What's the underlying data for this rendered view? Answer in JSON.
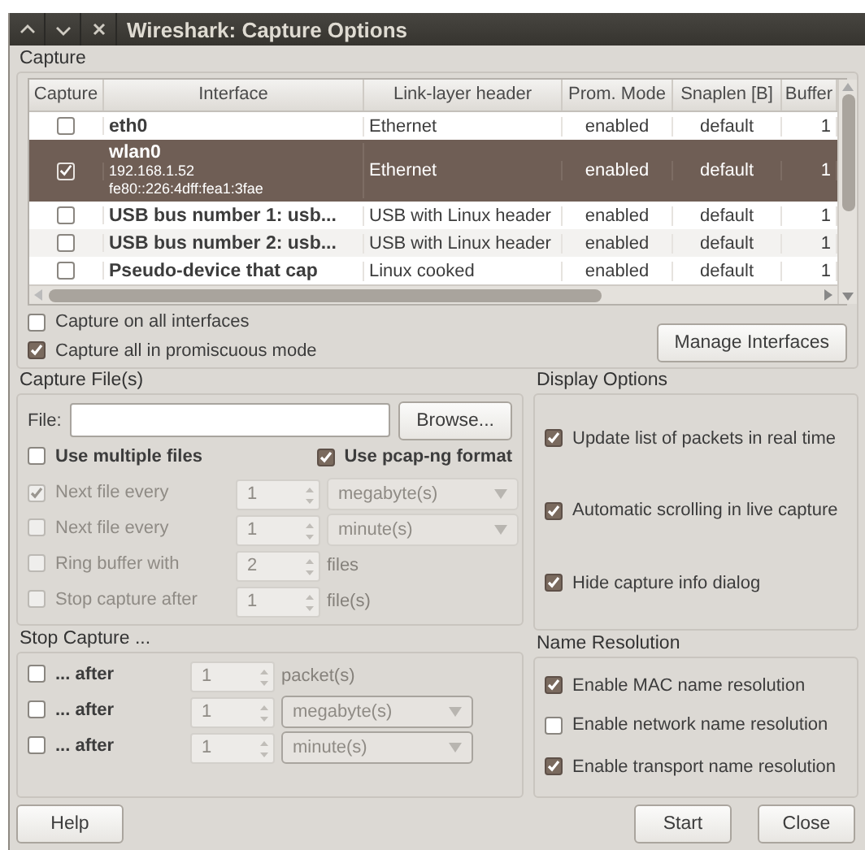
{
  "window": {
    "title": "Wireshark: Capture Options"
  },
  "capture": {
    "title": "Capture",
    "table": {
      "columns": [
        "Capture",
        "Interface",
        "Link-layer header",
        "Prom. Mode",
        "Snaplen [B]",
        "Buffer"
      ],
      "rows": [
        {
          "checked": false,
          "selected": false,
          "name": "eth0",
          "details": [],
          "link": "Ethernet",
          "prom": "enabled",
          "snaplen": "default",
          "buffer": "1"
        },
        {
          "checked": true,
          "selected": true,
          "name": "wlan0",
          "details": [
            "192.168.1.52",
            "fe80::226:4dff:fea1:3fae"
          ],
          "link": "Ethernet",
          "prom": "enabled",
          "snaplen": "default",
          "buffer": "1"
        },
        {
          "checked": false,
          "selected": false,
          "name": "USB bus number 1: usb...",
          "details": [],
          "link": "USB with Linux header",
          "prom": "enabled",
          "snaplen": "default",
          "buffer": "1"
        },
        {
          "checked": false,
          "selected": false,
          "name": "USB bus number 2: usb...",
          "details": [],
          "link": "USB with Linux header",
          "prom": "enabled",
          "snaplen": "default",
          "buffer": "1"
        },
        {
          "checked": false,
          "selected": false,
          "name": "Pseudo-device that cap",
          "details": [],
          "link": "Linux cooked",
          "prom": "enabled",
          "snaplen": "default",
          "buffer": "1"
        }
      ]
    },
    "options": [
      {
        "label": "Capture on all interfaces",
        "checked": false
      },
      {
        "label": "Capture all in promiscuous mode",
        "checked": true
      }
    ],
    "manage_button": "Manage Interfaces"
  },
  "capture_files": {
    "title": "Capture File(s)",
    "file_label": "File:",
    "browse_button": "Browse...",
    "multiple_files": {
      "label": "Use multiple files",
      "checked": false
    },
    "pcapng": {
      "label": "Use pcap-ng format",
      "checked": true
    },
    "rows": [
      {
        "label": "Next file every",
        "checked": true,
        "disabled": true,
        "value": "1",
        "unit": "megabyte(s)",
        "kind": "dropdown"
      },
      {
        "label": "Next file every",
        "checked": false,
        "disabled": true,
        "value": "1",
        "unit": "minute(s)",
        "kind": "dropdown"
      },
      {
        "label": "Ring buffer with",
        "checked": false,
        "disabled": true,
        "value": "2",
        "unit": "files",
        "kind": "text"
      },
      {
        "label": "Stop capture after",
        "checked": false,
        "disabled": true,
        "value": "1",
        "unit": "file(s)",
        "kind": "text"
      }
    ]
  },
  "stop_capture": {
    "title": "Stop Capture ...",
    "rows": [
      {
        "label": "... after",
        "checked": false,
        "disabled": false,
        "value": "1",
        "unit": "packet(s)",
        "kind": "text"
      },
      {
        "label": "... after",
        "checked": false,
        "disabled": false,
        "value": "1",
        "unit": "megabyte(s)",
        "kind": "dropdown"
      },
      {
        "label": "... after",
        "checked": false,
        "disabled": false,
        "value": "1",
        "unit": "minute(s)",
        "kind": "dropdown"
      }
    ]
  },
  "display_options": {
    "title": "Display Options",
    "items": [
      {
        "label": "Update list of packets in real time",
        "checked": true
      },
      {
        "label": "Automatic scrolling in live capture",
        "checked": true
      },
      {
        "label": "Hide capture info dialog",
        "checked": true
      }
    ]
  },
  "name_resolution": {
    "title": "Name Resolution",
    "items": [
      {
        "label": "Enable MAC name resolution",
        "checked": true
      },
      {
        "label": "Enable network name resolution",
        "checked": false
      },
      {
        "label": "Enable transport name resolution",
        "checked": true
      }
    ]
  },
  "buttons": {
    "help": "Help",
    "start": "Start",
    "close": "Close"
  }
}
